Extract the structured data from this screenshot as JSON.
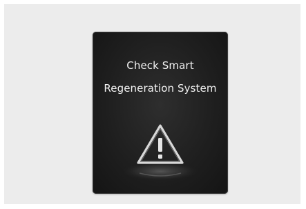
{
  "warning_display": {
    "message_line_1": "Check Smart",
    "message_line_2": "Regeneration System",
    "icon": "warning-triangle-icon"
  }
}
